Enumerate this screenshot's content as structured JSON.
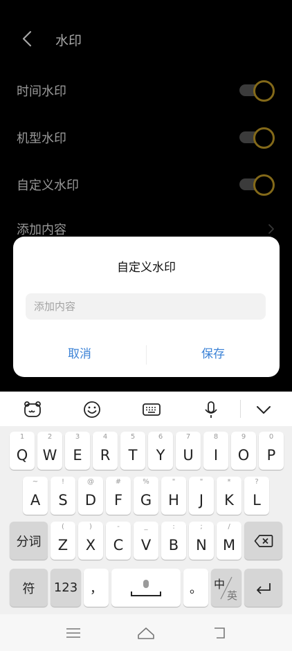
{
  "header": {
    "title": "水印"
  },
  "settings": [
    {
      "label": "时间水印",
      "on": true
    },
    {
      "label": "机型水印",
      "on": true
    },
    {
      "label": "自定义水印",
      "on": true
    }
  ],
  "add_content_row": {
    "label": "添加内容"
  },
  "dialog": {
    "title": "自定义水印",
    "input_placeholder": "添加内容",
    "input_value": "",
    "cancel_label": "取消",
    "save_label": "保存"
  },
  "keyboard": {
    "row1": [
      {
        "sub": "1",
        "main": "Q"
      },
      {
        "sub": "2",
        "main": "W"
      },
      {
        "sub": "3",
        "main": "E"
      },
      {
        "sub": "4",
        "main": "R"
      },
      {
        "sub": "5",
        "main": "T"
      },
      {
        "sub": "6",
        "main": "Y"
      },
      {
        "sub": "7",
        "main": "U"
      },
      {
        "sub": "8",
        "main": "I"
      },
      {
        "sub": "9",
        "main": "O"
      },
      {
        "sub": "0",
        "main": "P"
      }
    ],
    "row2": [
      {
        "sub": "~",
        "main": "A"
      },
      {
        "sub": "!",
        "main": "S"
      },
      {
        "sub": "@",
        "main": "D"
      },
      {
        "sub": "#",
        "main": "F"
      },
      {
        "sub": "%",
        "main": "G"
      },
      {
        "sub": "\"",
        "main": "H"
      },
      {
        "sub": "\"",
        "main": "J"
      },
      {
        "sub": "*",
        "main": "K"
      },
      {
        "sub": "?",
        "main": "L"
      }
    ],
    "row3": [
      {
        "sub": "(",
        "main": "Z"
      },
      {
        "sub": ")",
        "main": "X"
      },
      {
        "sub": "-",
        "main": "C"
      },
      {
        "sub": "_",
        "main": "V"
      },
      {
        "sub": ":",
        "main": "B"
      },
      {
        "sub": ";",
        "main": "N"
      },
      {
        "sub": "/",
        "main": "M"
      }
    ],
    "fn": {
      "word_label": "分词",
      "symbol_label": "符",
      "number_label": "123",
      "comma_label": "，",
      "period_label": "。",
      "lang_cn": "中",
      "lang_en": "英"
    }
  },
  "colors": {
    "accent": "#c9a227",
    "link": "#3b82d6"
  }
}
